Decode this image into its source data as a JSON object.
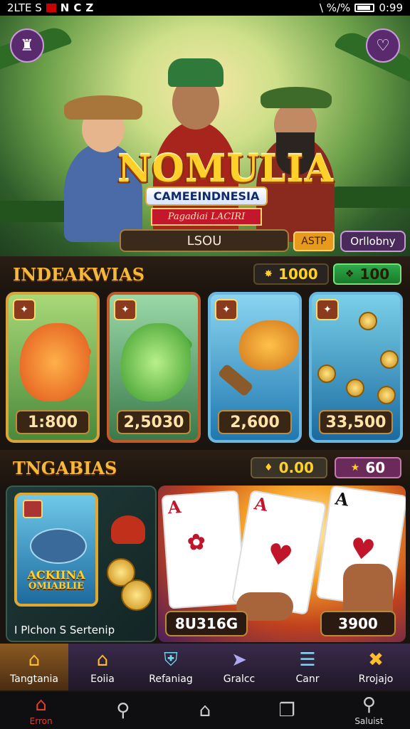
{
  "status_bar": {
    "carrier": "2LTE S",
    "icons_left": [
      "app-icon",
      "n-icon",
      "c-icon",
      "z-icon"
    ],
    "left_glyphs": [
      "N",
      "C",
      "Z"
    ],
    "signal_text": "\\ %/%",
    "time": "0:99"
  },
  "hero": {
    "logo_title": "NOMULIA",
    "logo_subtitle": "CAMEEINDNESIA",
    "logo_ribbon": "Pagadiai LACIRI",
    "search_value": "LSOU",
    "tag_one": "ASTP",
    "tag_two": "Orllobny"
  },
  "section_one": {
    "title": "INDEAKWIAS",
    "pill_gold": "1000",
    "pill_green": "100",
    "cards": [
      {
        "value": "1:800",
        "theme": "orange-fish"
      },
      {
        "value": "2,5030",
        "theme": "green-fish"
      },
      {
        "value": "2,600",
        "theme": "jumping-fish"
      },
      {
        "value": "33,500",
        "theme": "coins"
      }
    ]
  },
  "section_two": {
    "title": "TNGABIAS",
    "pill_dark": "0.00",
    "pill_purple": "60",
    "featured_left": {
      "art_title_1": "ACKIINA",
      "art_title_2": "OMIABLIE",
      "caption": "I Plchon S Sertenip"
    },
    "featured_right": {
      "card_rank": "A",
      "value_left": "8U316G",
      "value_right": "3900"
    }
  },
  "nav": {
    "items": [
      {
        "label": "Tangtania",
        "icon": "home-icon"
      },
      {
        "label": "Eoiia",
        "icon": "house-icon"
      },
      {
        "label": "Refaniag",
        "icon": "shield-icon"
      },
      {
        "label": "Gralcc",
        "icon": "send-icon"
      },
      {
        "label": "Canr",
        "icon": "list-icon"
      },
      {
        "label": "Rrojajo",
        "icon": "cross-icon"
      }
    ]
  },
  "system_nav": {
    "home_label": "Erron",
    "saluist_label": "Saluist"
  },
  "colors": {
    "accent_gold": "#f4b83a",
    "nav_bg": "#3a2a4a",
    "active_nav": "#8a5a22"
  }
}
